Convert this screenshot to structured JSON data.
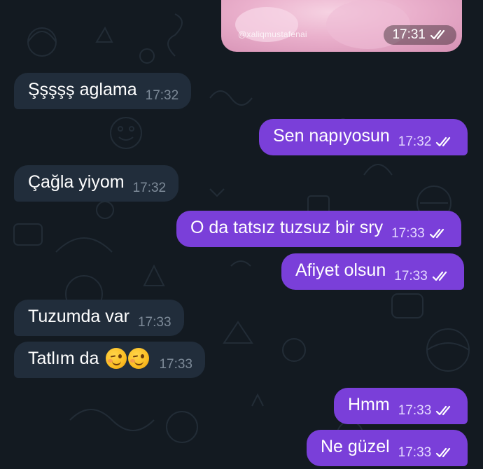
{
  "media": {
    "watermark": "@xaliqmustafenai",
    "time": "17:31"
  },
  "messages": [
    {
      "dir": "in",
      "text": "Şşşşş aglama",
      "time": "17:32"
    },
    {
      "dir": "out",
      "text": "Sen napıyosun",
      "time": "17:32"
    },
    {
      "dir": "in",
      "text": "Çağla yiyom",
      "time": "17:32"
    },
    {
      "dir": "out",
      "text": "O da tatsız tuzsuz bir sry",
      "time": "17:33"
    },
    {
      "dir": "out",
      "text": "Afiyet olsun",
      "time": "17:33"
    },
    {
      "dir": "in",
      "text": "Tuzumda var",
      "time": "17:33"
    },
    {
      "dir": "in",
      "text": "Tatlım da",
      "time": "17:33",
      "emoji": [
        "winking-face",
        "winking-face"
      ]
    },
    {
      "dir": "out",
      "text": "Hmm",
      "time": "17:33"
    },
    {
      "dir": "out",
      "text": "Ne güzel",
      "time": "17:33"
    }
  ],
  "colors": {
    "background": "#131a21",
    "incoming_bubble": "#212d3b",
    "outgoing_bubble": "#7a3fd9"
  }
}
